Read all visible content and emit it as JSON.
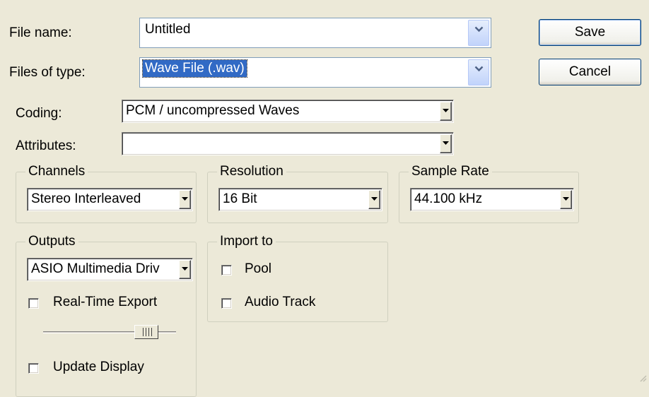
{
  "file": {
    "name_label": "File name:",
    "name_value": "Untitled",
    "type_label": "Files of type:",
    "type_value": "Wave File (.wav)"
  },
  "buttons": {
    "save": "Save",
    "cancel": "Cancel"
  },
  "coding": {
    "label": "Coding:",
    "value": "PCM / uncompressed Waves"
  },
  "attributes": {
    "label": "Attributes:",
    "value": ""
  },
  "channels": {
    "title": "Channels",
    "value": "Stereo Interleaved"
  },
  "resolution": {
    "title": "Resolution",
    "value": "16 Bit"
  },
  "sample_rate": {
    "title": "Sample Rate",
    "value": "44.100 kHz"
  },
  "outputs": {
    "title": "Outputs",
    "driver": "ASIO Multimedia Driv",
    "realtime_export": "Real-Time Export",
    "update_display": "Update Display"
  },
  "import_to": {
    "title": "Import to",
    "pool": "Pool",
    "audio_track": "Audio Track"
  },
  "colors": {
    "face": "#ece9d8",
    "selection": "#316ac5",
    "xp_border": "#7f9db9"
  }
}
